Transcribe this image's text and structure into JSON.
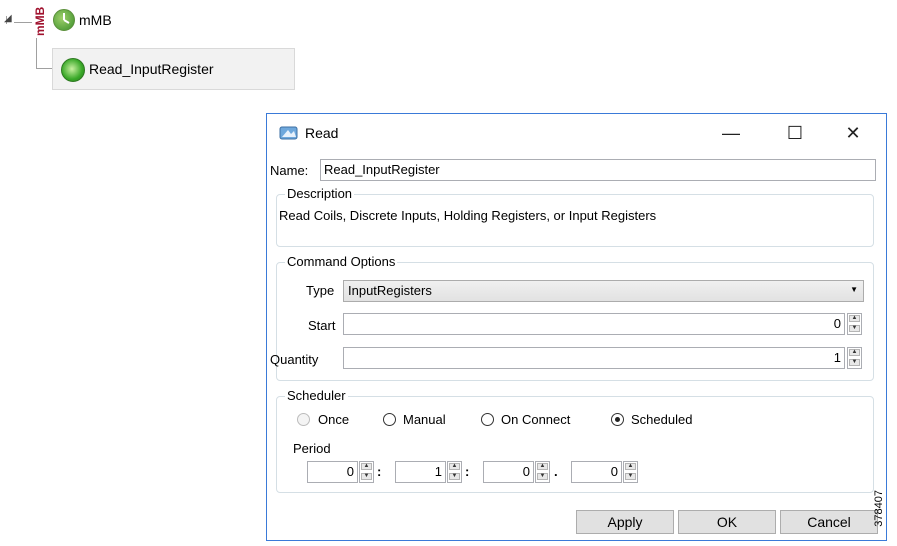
{
  "tree": {
    "root_badge": "mMB",
    "root_label": "mMB",
    "child_label": "Read_InputRegister"
  },
  "dialog": {
    "title": "Read",
    "window_buttons": {
      "minimize": "—",
      "maximize": "☐",
      "close": "✕"
    },
    "name_label": "Name:",
    "name_value": "Read_InputRegister",
    "description_legend": "Description",
    "description_text": "Read Coils, Discrete Inputs, Holding Registers, or Input Registers",
    "command_options_legend": "Command Options",
    "type_label": "Type",
    "type_value": "InputRegisters",
    "start_label": "Start",
    "start_value": "0",
    "quantity_label": "Quantity",
    "quantity_value": "1",
    "scheduler_legend": "Scheduler",
    "radio_once": "Once",
    "radio_manual": "Manual",
    "radio_on_connect": "On Connect",
    "radio_scheduled": "Scheduled",
    "selected_schedule": "Scheduled",
    "period_label": "Period",
    "period": {
      "p1": "0",
      "p2": "1",
      "p3": "0",
      "p4": "0",
      "sep1": ":",
      "sep2": ":",
      "sep3": "."
    },
    "apply_label": "Apply",
    "ok_label": "OK",
    "cancel_label": "Cancel"
  },
  "figure_id": "378407",
  "colors": {
    "accent": "#3a7ad8",
    "badge": "#a0122e"
  }
}
